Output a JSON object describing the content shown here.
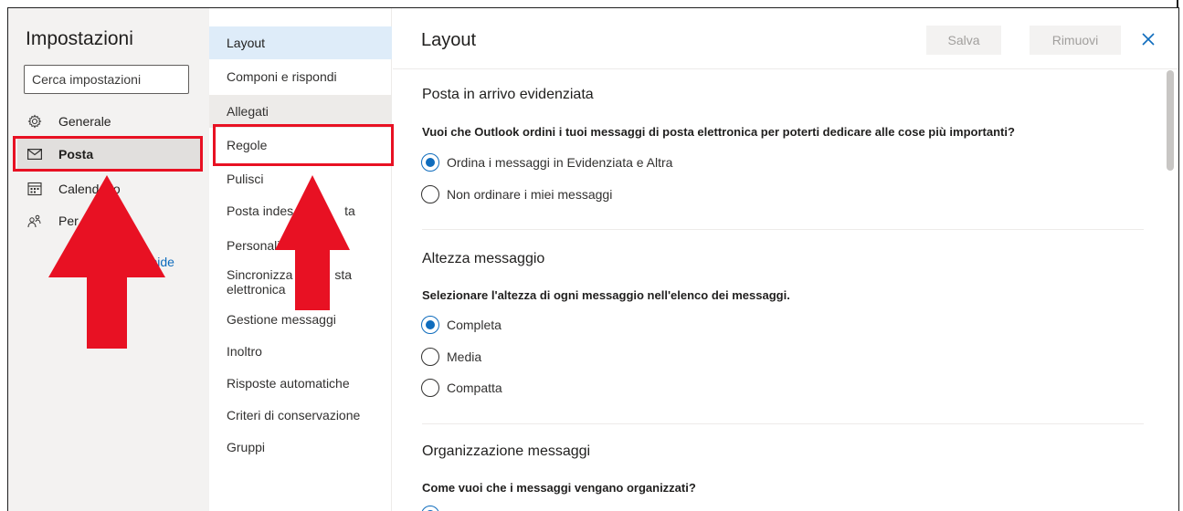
{
  "left_nav": {
    "title": "Impostazioni",
    "search_placeholder": "Cerca impostazioni",
    "items": [
      {
        "label": "Generale",
        "icon": "gear-icon"
      },
      {
        "label": "Posta",
        "icon": "mail-icon"
      },
      {
        "label": "Calendario",
        "icon": "calendar-icon"
      },
      {
        "label": "Per",
        "icon": "people-icon"
      }
    ],
    "quick_link_fragment": "rapide"
  },
  "mid_nav": {
    "items": [
      "Layout",
      "Componi e rispondi",
      "Allegati",
      "Regole",
      "Pulisci",
      "Posta indes",
      "Personali",
      "Sincronizza",
      "Gestione messaggi",
      "Inoltro",
      "Risposte automatiche",
      "Criteri di conservazione",
      "Gruppi"
    ],
    "item_fragments": {
      "posta_suffix": "ta",
      "personali_suffix": "",
      "sync_line2": "elettronica",
      "sync_suffix": "sta"
    }
  },
  "main": {
    "title": "Layout",
    "save_label": "Salva",
    "remove_label": "Rimuovi",
    "close_icon": "close-icon",
    "sections": [
      {
        "heading": "Posta in arrivo evidenziata",
        "question": "Vuoi che Outlook ordini i tuoi messaggi di posta elettronica per poterti dedicare alle cose più importanti?",
        "options": [
          "Ordina i messaggi in Evidenziata e Altra",
          "Non ordinare i miei messaggi"
        ],
        "selected": 0
      },
      {
        "heading": "Altezza messaggio",
        "question": "Selezionare l'altezza di ogni messaggio nell'elenco dei messaggi.",
        "options": [
          "Completa",
          "Media",
          "Compatta"
        ],
        "selected": 0
      },
      {
        "heading": "Organizzazione messaggi",
        "question": "Come vuoi che i messaggi vengano organizzati?"
      }
    ]
  },
  "colors": {
    "accent": "#0f6cbd",
    "annotation": "#e81123"
  }
}
